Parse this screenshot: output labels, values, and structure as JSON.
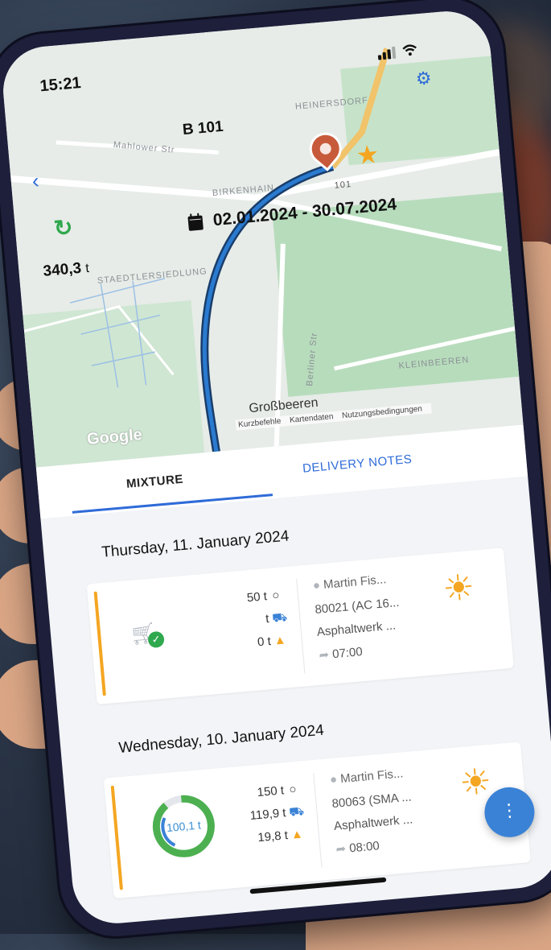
{
  "status_bar": {
    "time": "15:21"
  },
  "map": {
    "route_title": "B 101",
    "date_range": "02.01.2024 - 30.07.2024",
    "tonnage_value": "340,3",
    "tonnage_unit": "t",
    "labels": {
      "mahlower": "Mahlower Str",
      "heinersdorf": "HEINERSDORF",
      "birkenhain": "BIRKENHAIN",
      "staedtler": "STAEDTLERSIEDLUNG",
      "kleinbeeren": "KLEINBEEREN",
      "berliner": "Berliner Str",
      "road_101": "101",
      "town": "Großbeeren",
      "google": "Google"
    },
    "attribution": [
      "Kurzbefehle",
      "Kartendaten",
      "Nutzungsbedingungen"
    ]
  },
  "tabs": {
    "mixture": "MIXTURE",
    "delivery_notes": "DELIVERY NOTES"
  },
  "days": [
    {
      "header": "Thursday, 11. January 2024",
      "entry": {
        "qty_ordered": "50 t",
        "qty_delivered": "t",
        "qty_remaining": "0 t",
        "driver": "Martin Fis...",
        "order": "80021 (AC 16...",
        "plant": "Asphaltwerk ...",
        "time": "07:00"
      }
    },
    {
      "header": "Wednesday, 10. January 2024",
      "entry": {
        "progress_label": "100,1 t",
        "progress_fraction": 0.9,
        "qty_ordered": "150 t",
        "qty_delivered": "119,9 t",
        "qty_remaining": "19,8 t",
        "driver": "Martin Fis...",
        "order": "80063 (SMA ...",
        "plant": "Asphaltwerk ...",
        "time": "08:00"
      }
    }
  ],
  "colors": {
    "accent": "#2f6bd8",
    "orange": "#f4a622",
    "green": "#2fa84e"
  }
}
